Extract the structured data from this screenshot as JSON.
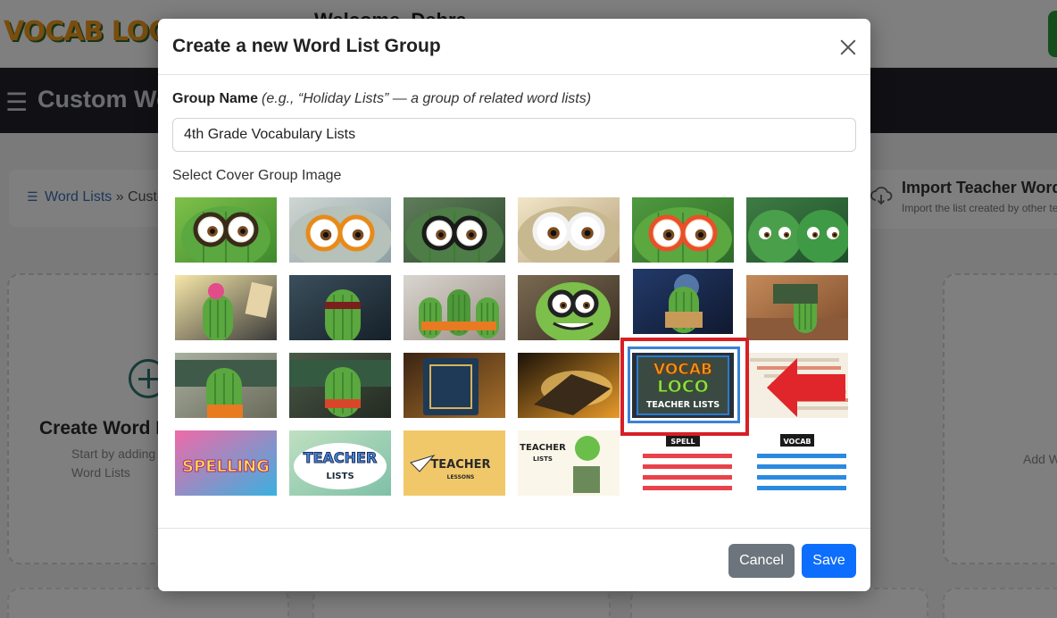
{
  "app": {
    "logo_text": "VOCAB LOCO",
    "welcome": "Welcome, Debra",
    "page_title": "Custom Word Lists",
    "breadcrumb": {
      "root": "Word Lists",
      "separator": "»",
      "current": "Custom Word Lists"
    },
    "import_card": {
      "title": "Import Teacher Word List",
      "subtitle": "Import the list created by other teachers"
    },
    "create_card": {
      "title": "Create Word List",
      "subtitle": "Start by adding a new list to your Word Lists"
    },
    "add_card": {
      "text": "Add Word List"
    }
  },
  "modal": {
    "title": "Create a new Word List Group",
    "close_icon": "close-icon",
    "group_name_label": "Group Name",
    "group_name_hint": "(e.g., “Holiday Lists” — a group of related word lists)",
    "group_name_value": "4th Grade Vocabulary Lists",
    "cover_label": "Select Cover Group Image",
    "selected_index": 10,
    "images": [
      {
        "id": "cactus-green-glasses"
      },
      {
        "id": "cactus-orange-glasses"
      },
      {
        "id": "cactus-black-glasses"
      },
      {
        "id": "cactus-white-glasses"
      },
      {
        "id": "cactus-red-glasses"
      },
      {
        "id": "cactus-twins"
      },
      {
        "id": "cactus-word-list-sign"
      },
      {
        "id": "cactus-superhero"
      },
      {
        "id": "cactus-trio"
      },
      {
        "id": "cactus-phone"
      },
      {
        "id": "cactus-reading-night"
      },
      {
        "id": "cactus-classroom"
      },
      {
        "id": "cactus-teacher-board"
      },
      {
        "id": "cactus-scarf-classroom"
      },
      {
        "id": "word-list-book"
      },
      {
        "id": "word-list-glowing-book"
      },
      {
        "id": "vocab-loco-teacher-lists",
        "lines": [
          "VOCAB",
          "LOCO",
          "TEACHER LISTS"
        ]
      },
      {
        "id": "vocabulary-text-collage"
      },
      {
        "id": "spelling-graffiti",
        "lines": [
          "SPELLING"
        ]
      },
      {
        "id": "teacher-lists-badge",
        "lines": [
          "TEACHER",
          "LISTS"
        ]
      },
      {
        "id": "teacher-lessons-paper-plane",
        "lines": [
          "TEACHER",
          "LESSONS"
        ]
      },
      {
        "id": "teacher-lists-books-globe",
        "lines": [
          "TEACHER",
          "LISTS"
        ]
      },
      {
        "id": "spell-lines-red",
        "lines": [
          "SPELL"
        ]
      },
      {
        "id": "vocab-lines-blue",
        "lines": [
          "VOCAB"
        ]
      }
    ],
    "cancel_label": "Cancel",
    "save_label": "Save"
  },
  "colors": {
    "primary": "#0d6efd",
    "secondary": "#6c757d",
    "highlight_red": "#d61f26",
    "highlight_blue": "#3b82d6"
  }
}
